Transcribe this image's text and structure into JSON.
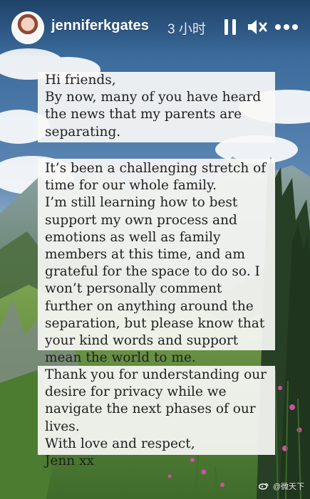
{
  "story": {
    "username": "jenniferkgates",
    "time": "3 小时",
    "paragraphs": [
      "Hi friends,\nBy now, many of you have heard the news that my parents are separating.",
      "It’s been a challenging stretch of time for our whole family.\nI’m still learning how to best support my own process and emotions as well as family members at this time, and am grateful for the space to do so. I won’t personally comment further on anything around the separation, but please know that your kind words and support mean the world to me.",
      "Thank you for understanding our desire for privacy while we navigate the next phases of our lives.\nWith love and respect,\nJenn xx"
    ],
    "watermark": "@微天下"
  },
  "icons": {
    "avatar": "avatar",
    "pause": "pause-icon",
    "mute": "mute-icon",
    "more": "more-icon",
    "watermark": "weibo-icon"
  },
  "colors": {
    "sky": "#5d87b4",
    "mountain": "#5e7a55",
    "foliage": "#5c8a3d",
    "card": "#f5f5f3",
    "text": "#1f1f1f"
  }
}
